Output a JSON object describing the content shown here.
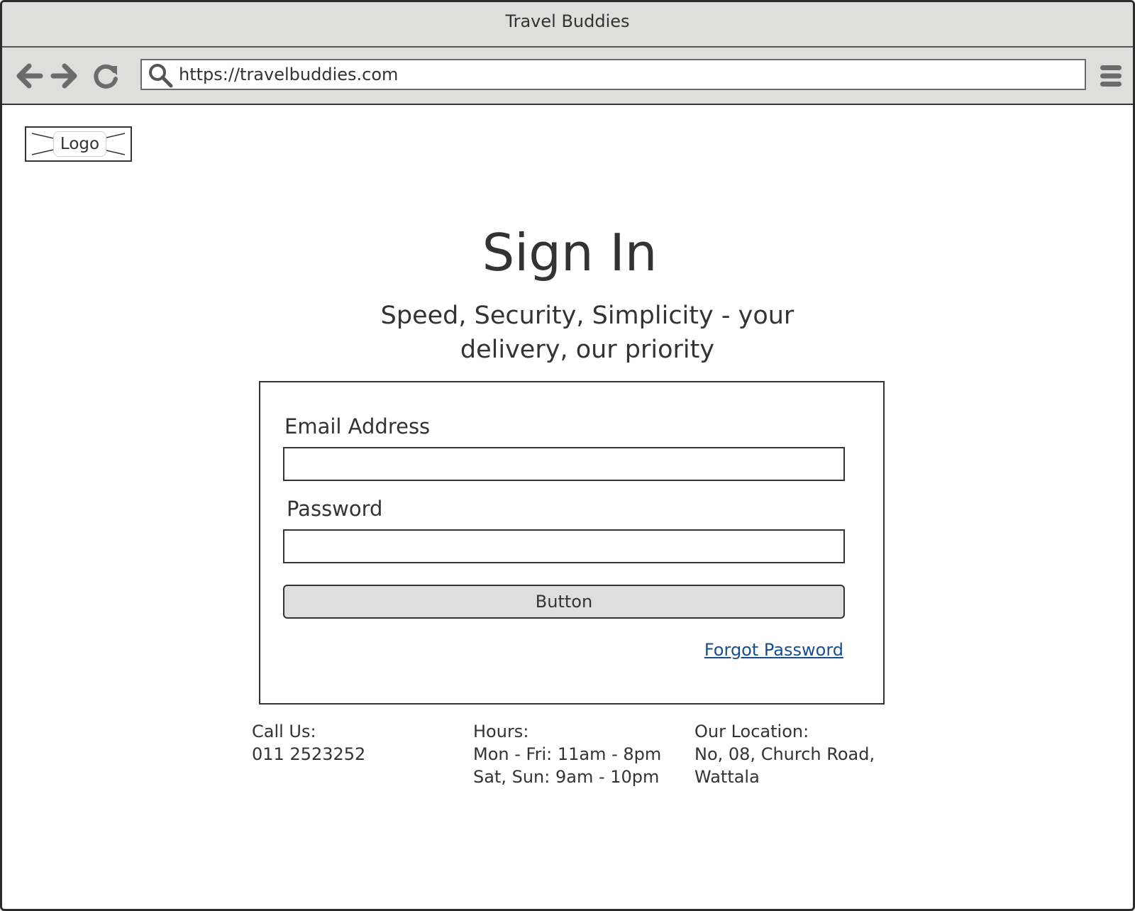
{
  "window": {
    "title": "Travel Buddies"
  },
  "browser": {
    "url": "https://travelbuddies.com",
    "icons": [
      "back-arrow-icon",
      "forward-arrow-icon",
      "reload-icon",
      "search-icon",
      "hamburger-menu-icon"
    ]
  },
  "logo": {
    "label": "Logo"
  },
  "page": {
    "title": "Sign In",
    "subtitle_line1": "Speed, Security, Simplicity - your",
    "subtitle_line2": "delivery, our priority"
  },
  "form": {
    "email_label": "Email Address",
    "email_value": "",
    "password_label": "Password",
    "password_value": "",
    "submit_label": "Button",
    "forgot_label": "Forgot Password"
  },
  "footer": {
    "call": {
      "heading": "Call Us:",
      "phone": "011 2523252"
    },
    "hours": {
      "heading": "Hours:",
      "weekdays": "Mon - Fri: 11am - 8pm",
      "weekend": "Sat, Sun: 9am - 10pm"
    },
    "location": {
      "heading": "Our Location:",
      "line1": "No, 08, Church Road,",
      "line2": "Wattala"
    }
  },
  "colors": {
    "chrome_bg": "#dededc",
    "link": "#174f8c",
    "button_bg": "#dedede",
    "text": "#333333"
  }
}
